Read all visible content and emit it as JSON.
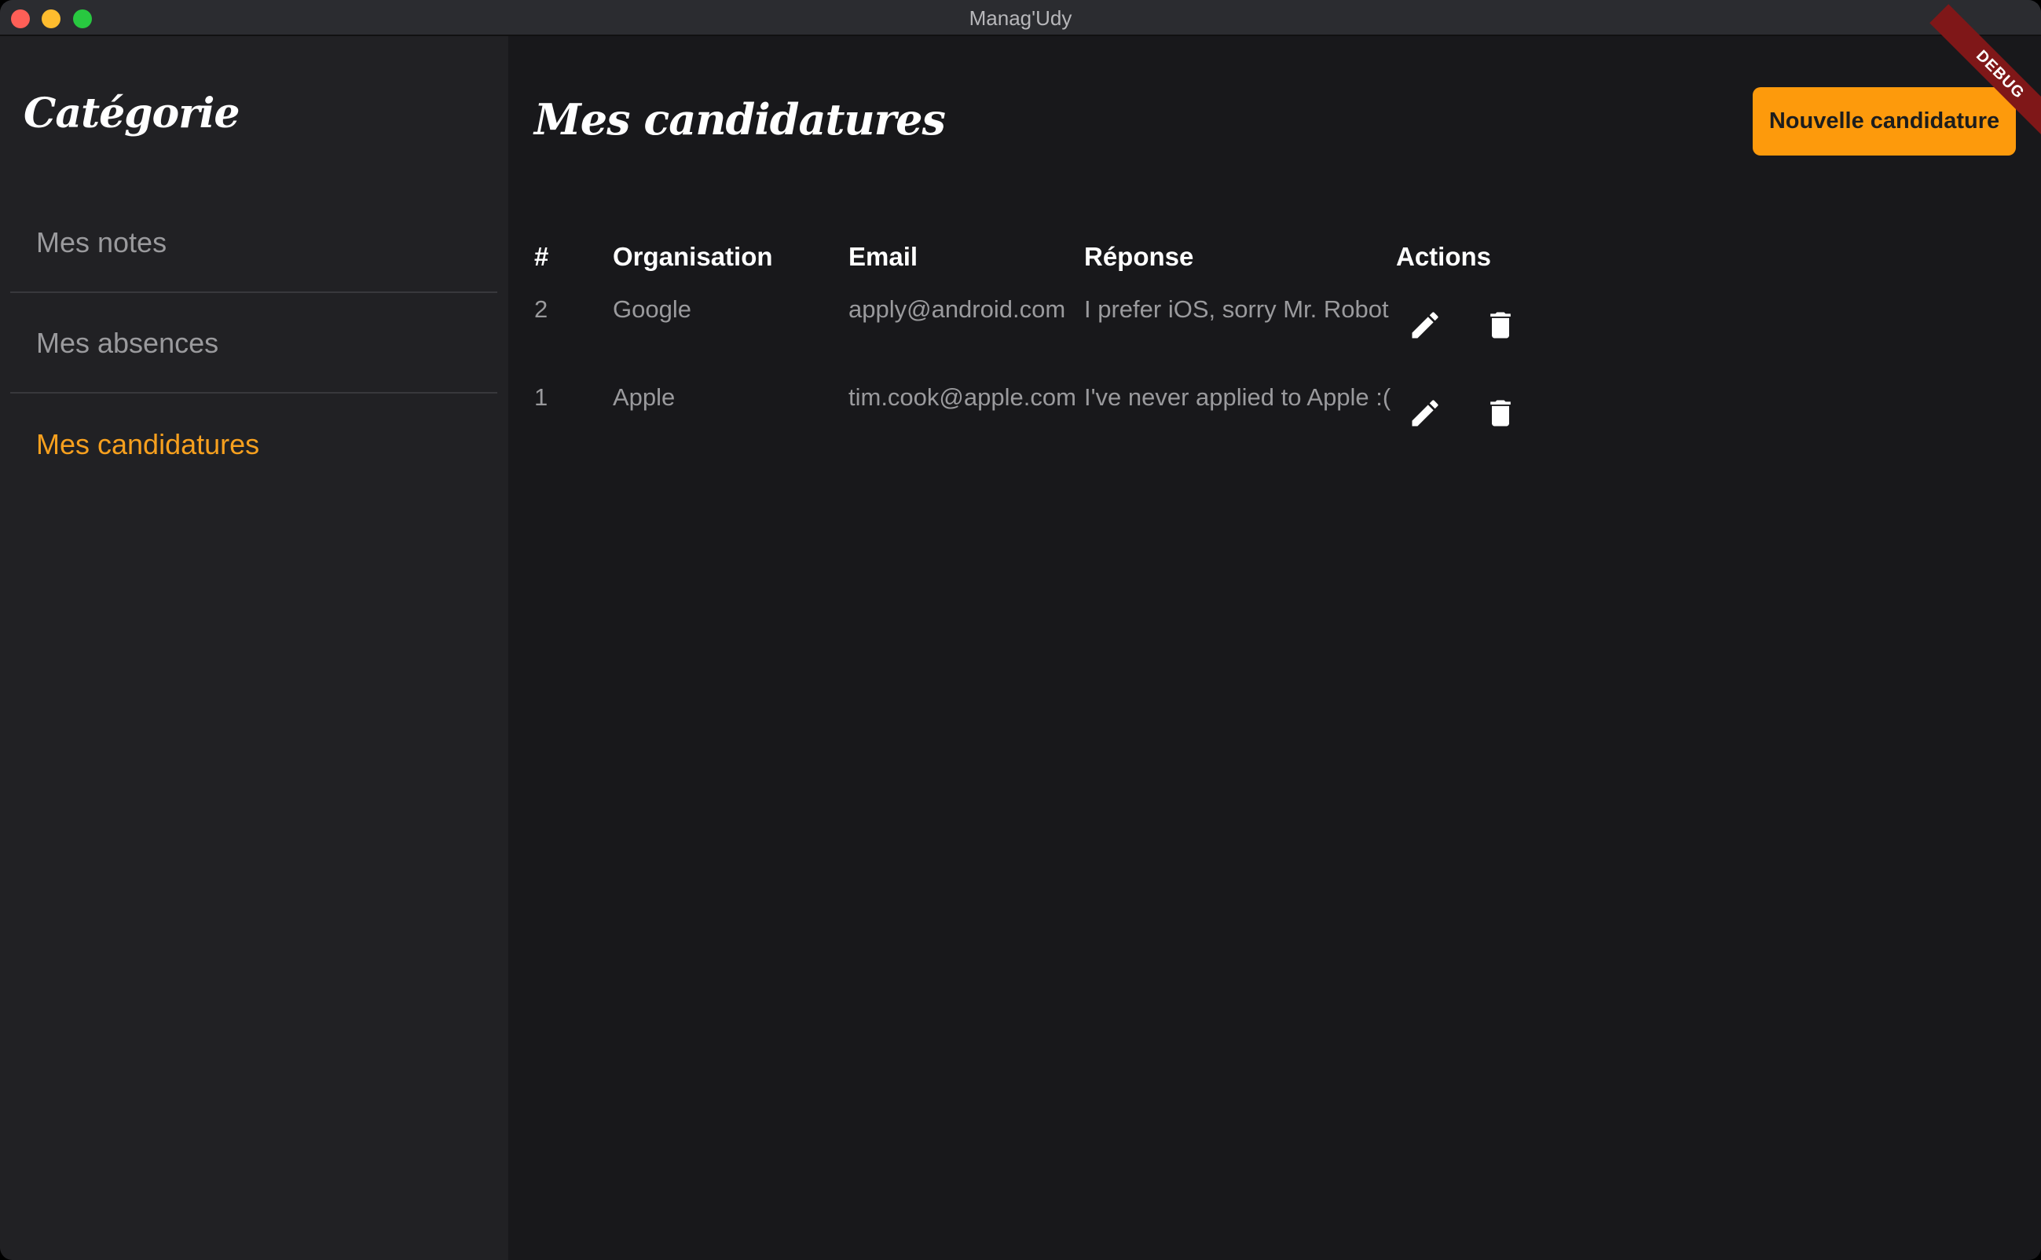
{
  "window": {
    "title": "Manag'Udy"
  },
  "sidebar": {
    "title": "Catégorie",
    "items": [
      {
        "label": "Mes notes",
        "active": false
      },
      {
        "label": "Mes absences",
        "active": false
      },
      {
        "label": "Mes candidatures",
        "active": true
      }
    ]
  },
  "main": {
    "title": "Mes candidatures",
    "new_button_label": "Nouvelle candidature",
    "debug_label": "DEBUG",
    "table": {
      "headers": [
        "#",
        "Organisation",
        "Email",
        "Réponse",
        "Actions"
      ],
      "rows": [
        {
          "id": "2",
          "organisation": "Google",
          "email": "apply@android.com",
          "reponse": "I prefer iOS, sorry Mr. Robot",
          "actions": [
            "edit-icon",
            "delete-icon"
          ]
        },
        {
          "id": "1",
          "organisation": "Apple",
          "email": "tim.cook@apple.com",
          "reponse": "I've never applied to Apple :(",
          "actions": [
            "edit-icon",
            "delete-icon"
          ]
        }
      ]
    }
  },
  "colors": {
    "accent": "#fd9a0c",
    "active_nav": "#f7a01e",
    "sidebar_bg": "#212124",
    "main_bg": "#18181b",
    "debug_ribbon": "#7f1718"
  }
}
